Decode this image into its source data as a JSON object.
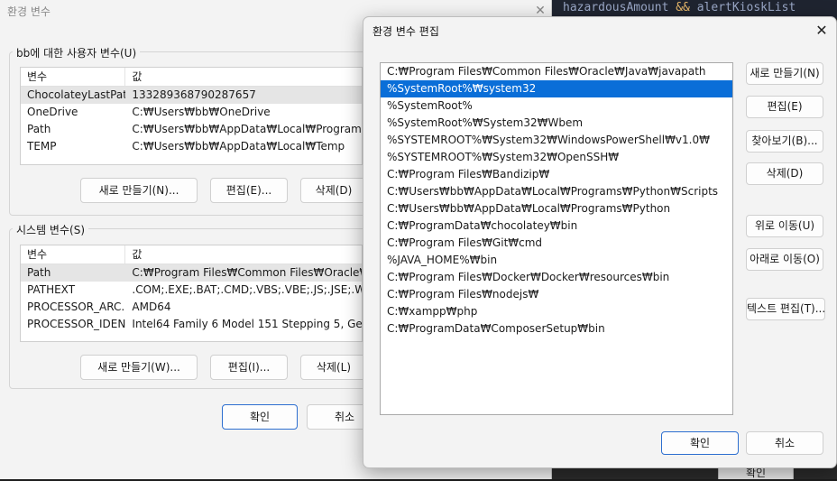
{
  "background": {
    "code_line": [
      "hazardousAmount ",
      "&&",
      " alertKioskList"
    ],
    "bottom_button_label": "확인"
  },
  "main_window": {
    "title": "환경 변수",
    "close_glyph": "✕",
    "user_vars": {
      "group_label": "bb에 대한 사용자 변수(U)",
      "columns": [
        "변수",
        "값"
      ],
      "rows": [
        {
          "name": "ChocolateyLastPat...",
          "value": "133289368790287657"
        },
        {
          "name": "OneDrive",
          "value": "C:₩Users₩bb₩OneDrive"
        },
        {
          "name": "Path",
          "value": "C:₩Users₩bb₩AppData₩Local₩Programs₩..."
        },
        {
          "name": "TEMP",
          "value": "C:₩Users₩bb₩AppData₩Local₩Temp"
        }
      ],
      "buttons": {
        "new": "새로 만들기(N)...",
        "edit": "편집(E)...",
        "delete": "삭제(D)"
      }
    },
    "system_vars": {
      "group_label": "시스템 변수(S)",
      "columns": [
        "변수",
        "값"
      ],
      "rows": [
        {
          "name": "Path",
          "value": "C:₩Program Files₩Common Files₩Oracle₩..."
        },
        {
          "name": "PATHEXT",
          "value": ".COM;.EXE;.BAT;.CMD;.VBS;.VBE;.JS;.JSE;.W..."
        },
        {
          "name": "PROCESSOR_ARC...",
          "value": "AMD64"
        },
        {
          "name": "PROCESSOR_IDEN...",
          "value": "Intel64 Family 6 Model 151 Stepping 5, Ge..."
        }
      ],
      "buttons": {
        "new": "새로 만들기(W)...",
        "edit": "편집(I)...",
        "delete": "삭제(L)"
      }
    },
    "ok_label": "확인",
    "cancel_label": "취소"
  },
  "edit_dialog": {
    "title": "환경 변수 편집",
    "close_glyph": "✕",
    "entries": [
      "C:₩Program Files₩Common Files₩Oracle₩Java₩javapath",
      "%SystemRoot%₩system32",
      "%SystemRoot%",
      "%SystemRoot%₩System32₩Wbem",
      "%SYSTEMROOT%₩System32₩WindowsPowerShell₩v1.0₩",
      "%SYSTEMROOT%₩System32₩OpenSSH₩",
      "C:₩Program Files₩Bandizip₩",
      "C:₩Users₩bb₩AppData₩Local₩Programs₩Python₩Scripts",
      "C:₩Users₩bb₩AppData₩Local₩Programs₩Python",
      "C:₩ProgramData₩chocolatey₩bin",
      "C:₩Program Files₩Git₩cmd",
      "%JAVA_HOME%₩bin",
      "C:₩Program Files₩Docker₩Docker₩resources₩bin",
      "C:₩Program Files₩nodejs₩",
      "C:₩xampp₩php",
      "C:₩ProgramData₩ComposerSetup₩bin"
    ],
    "selected_index": 1,
    "buttons": {
      "new": "새로 만들기(N)",
      "edit": "편집(E)",
      "browse": "찾아보기(B)...",
      "delete": "삭제(D)",
      "move_up": "위로 이동(U)",
      "move_down": "아래로 이동(O)",
      "edit_text": "텍스트 편집(T)...",
      "ok": "확인",
      "cancel": "취소"
    }
  },
  "colors": {
    "selection": "#0a6ed8",
    "primary_border": "#2d6fd0"
  }
}
